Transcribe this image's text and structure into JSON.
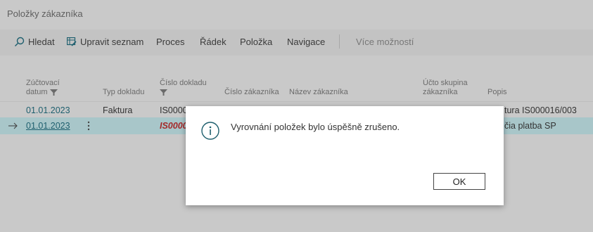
{
  "page": {
    "title": "Položky zákazníka"
  },
  "actions": {
    "search": "Hledat",
    "edit_list": "Upravit seznam",
    "process": "Proces",
    "line": "Řádek",
    "entry": "Položka",
    "navigate": "Navigace",
    "more": "Více možností"
  },
  "columns": {
    "posting_date_1": "Zúčtovací",
    "posting_date_2": "datum",
    "doc_type": "Typ dokladu",
    "doc_no": "Číslo dokladu",
    "cust_no": "Číslo zákazníka",
    "cust_name": "Název zákazníka",
    "posting_group_1": "Účto skupina",
    "posting_group_2": "zákazníka",
    "description": "Popis"
  },
  "rows": [
    {
      "date": "01.01.2023",
      "doc_type": "Faktura",
      "doc_no": "IS0000",
      "description": "tura IS000016/003"
    },
    {
      "date": "01.01.2023",
      "doc_type": "",
      "doc_no": "IS0000",
      "description": "čia platba SP"
    }
  ],
  "dialog": {
    "message": "Vyrovnání položek bylo úspěšně zrušeno.",
    "ok": "OK"
  },
  "icons": [
    "search-icon",
    "edit-list-icon",
    "filter-icon",
    "arrow-right-icon",
    "more-vertical-icon",
    "info-icon"
  ],
  "colors": {
    "accent": "#1e5f6e",
    "selected_row": "#a8c6c9",
    "overlay": "#c9c9c9",
    "error_text": "#a52a2a"
  }
}
